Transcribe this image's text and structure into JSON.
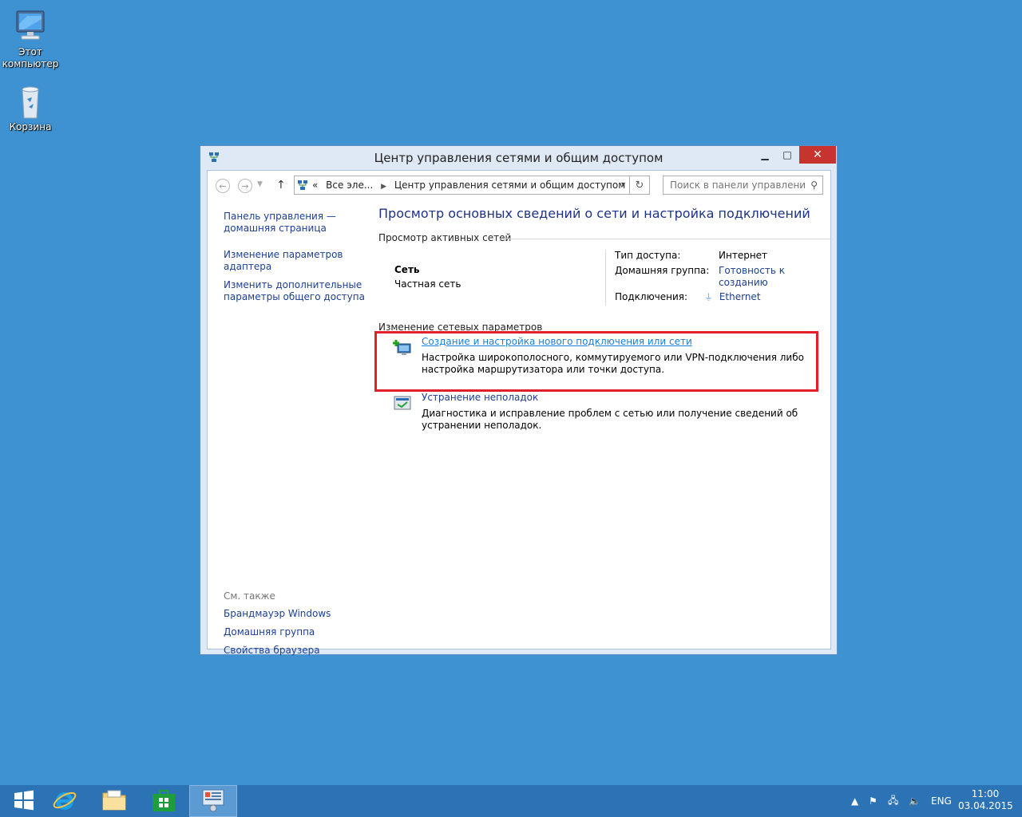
{
  "desktop": {
    "icons": [
      {
        "label_line1": "Этот",
        "label_line2": "компьютер",
        "icon": "computer-icon"
      },
      {
        "label_line1": "Корзина",
        "label_line2": "",
        "icon": "recycle-bin-icon"
      }
    ]
  },
  "window": {
    "title": "Центр управления сетями и общим доступом",
    "controls": {
      "minimize": "▁",
      "maximize": "□",
      "close": "✕"
    },
    "address": {
      "prefix": "«",
      "crumb1": "Все эле...",
      "crumb2": "Центр управления сетями и общим доступом"
    },
    "search": {
      "placeholder": "Поиск в панели управления"
    },
    "left": {
      "home_link": "Панель управления — домашняя страница",
      "adapter_link": "Изменение параметров адаптера",
      "sharing_link": "Изменить дополнительные параметры общего доступа",
      "see_also_header": "См. также",
      "see_also": [
        "Брандмауэр Windows",
        "Домашняя группа",
        "Свойства браузера"
      ]
    },
    "main": {
      "heading": "Просмотр основных сведений о сети и настройка подключений",
      "active_networks_header": "Просмотр активных сетей",
      "network_name": "Сеть",
      "network_type": "Частная сеть",
      "access_type_label": "Тип доступа:",
      "access_type_value": "Интернет",
      "homegroup_label": "Домашняя группа:",
      "homegroup_value": "Готовность к созданию",
      "connections_label": "Подключения:",
      "connections_value": "Ethernet",
      "change_settings_header": "Изменение сетевых параметров",
      "tasks": [
        {
          "link": "Создание и настройка нового подключения или сети",
          "desc": "Настройка широкополосного, коммутируемого или VPN-подключения либо настройка маршрутизатора или точки доступа.",
          "icon": "new-connection-icon"
        },
        {
          "link": "Устранение неполадок",
          "desc": "Диагностика и исправление проблем с сетью или получение сведений об устранении неполадок.",
          "icon": "troubleshoot-icon"
        }
      ]
    }
  },
  "taskbar": {
    "items": [
      "start-button",
      "internet-explorer",
      "file-explorer",
      "store",
      "control-panel"
    ],
    "tray": {
      "language": "ENG",
      "time": "11:00",
      "date": "03.04.2015"
    }
  }
}
